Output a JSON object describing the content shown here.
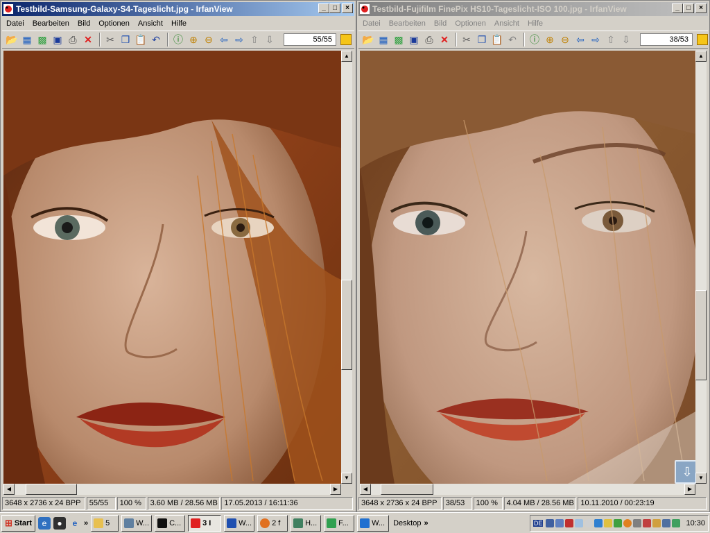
{
  "left_window": {
    "title": "Testbild-Samsung-Galaxy-S4-Tageslicht.jpg - IrfanView",
    "active": true,
    "menu": [
      "Datei",
      "Bearbeiten",
      "Bild",
      "Optionen",
      "Ansicht",
      "Hilfe"
    ],
    "page_counter": "55/55",
    "status": [
      "3648 x 2736 x 24 BPP",
      "55/55",
      "100 %",
      "3.60 MB / 28.56 MB",
      "17.05.2013 / 16:11:36"
    ],
    "vertical_scroll_fraction": 0.55,
    "horizontal_scroll_fraction": 0.08
  },
  "right_window": {
    "title": "Testbild-Fujifilm FinePix HS10-Tageslicht-ISO 100.jpg - IrfanView",
    "active": false,
    "menu": [
      "Datei",
      "Bearbeiten",
      "Bild",
      "Optionen",
      "Ansicht",
      "Hilfe"
    ],
    "page_counter": "38/53",
    "status": [
      "3648 x 2736 x 24 BPP",
      "38/53",
      "100 %",
      "4.04 MB / 28.56 MB",
      "10.11.2010 / 00:23:19"
    ],
    "vertical_scroll_fraction": 0.55,
    "horizontal_scroll_fraction": 0.08
  },
  "toolbar_icons": [
    "open-folder-icon",
    "slideshow-icon",
    "thumbnails-icon",
    "save-icon",
    "print-icon",
    "delete-icon",
    "cut-icon",
    "copy-icon",
    "paste-icon",
    "undo-icon",
    "info-icon",
    "zoom-in-icon",
    "zoom-out-icon",
    "previous-icon",
    "next-icon",
    "first-icon",
    "last-icon"
  ],
  "taskbar": {
    "start_label": "Start",
    "tasks": [
      {
        "label": "5",
        "icon": "folder-icon"
      },
      {
        "label": "W...",
        "icon": "window-icon"
      },
      {
        "label": "C...",
        "icon": "cmd-icon"
      },
      {
        "label": "3 I",
        "icon": "irfanview-icon",
        "pressed": true
      },
      {
        "label": "W...",
        "icon": "word-icon"
      },
      {
        "label": "2 f",
        "icon": "firefox-icon"
      },
      {
        "label": "H...",
        "icon": "app-icon"
      },
      {
        "label": "F...",
        "icon": "app-icon"
      },
      {
        "label": "W...",
        "icon": "browser-icon"
      }
    ],
    "desktop_label": "Desktop",
    "lang": "DE",
    "clock": "10:30"
  },
  "colors": {
    "active_title": "#0a246a",
    "inactive_title": "#808080",
    "window_bg": "#d4d0c8"
  }
}
